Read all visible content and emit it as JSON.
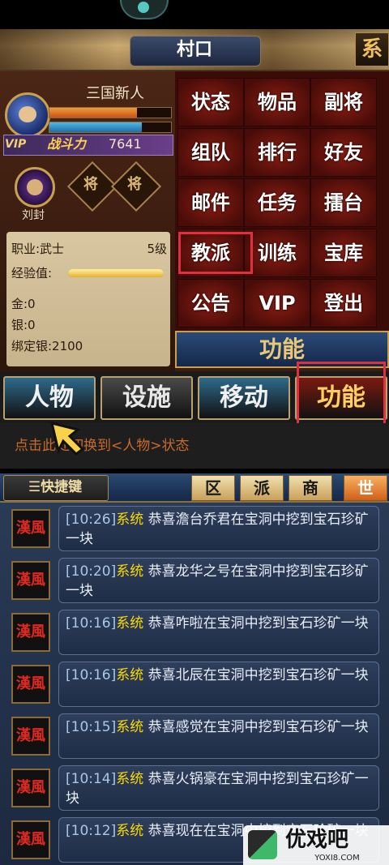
{
  "title": "村口",
  "title_right_glyph": "系",
  "character": {
    "name": "三国新人",
    "hp_fraction": 0.72,
    "mp_fraction": 0.76,
    "vip": "VIP",
    "power_label": "战斗力",
    "power_value": "7641"
  },
  "general": {
    "name": "刘封",
    "slot1": "将",
    "slot2": "将"
  },
  "info": {
    "career": "职业:武士",
    "level": "5级",
    "exp_label": "经验值:",
    "exp_fraction": 1.0,
    "gold": "金:0",
    "silver": "银:0",
    "bound_silver": "绑定银:2100"
  },
  "menu": {
    "rows": [
      [
        "状态",
        "物品",
        "副将"
      ],
      [
        "组队",
        "排行",
        "好友"
      ],
      [
        "邮件",
        "任务",
        "擂台"
      ],
      [
        "教派",
        "训练",
        "宝库"
      ],
      [
        "公告",
        "VIP",
        "登出"
      ]
    ],
    "header": "功能"
  },
  "tabs": [
    {
      "label": "人物",
      "color": "#f0f0f0",
      "bg": "#2e6a8a"
    },
    {
      "label": "设施",
      "color": "#e8e8e8",
      "bg": "#4a4a4a"
    },
    {
      "label": "移动",
      "color": "#f0f0f0",
      "bg": "#2e6a8a"
    },
    {
      "label": "功能",
      "color": "#ffd060",
      "bg": "#7a1a10"
    }
  ],
  "hint": "点击此处切换到<人物>状态",
  "shortcut": "☰快捷键",
  "channels": [
    "区",
    "派",
    "商",
    "世"
  ],
  "messages": [
    {
      "time": "[10:26]",
      "source": "系统",
      "text": "恭喜澹台乔君在宝洞中挖到宝石珍矿一块"
    },
    {
      "time": "[10:20]",
      "source": "系统",
      "text": "恭喜龙华之号在宝洞中挖到宝石珍矿一块"
    },
    {
      "time": "[10:16]",
      "source": "系统",
      "text": "恭喜咋啦在宝洞中挖到宝石珍矿一块"
    },
    {
      "time": "[10:16]",
      "source": "系统",
      "text": "恭喜北辰在宝洞中挖到宝石珍矿一块"
    },
    {
      "time": "[10:15]",
      "source": "系统",
      "text": "恭喜感觉在宝洞中挖到宝石珍矿一块"
    },
    {
      "time": "[10:14]",
      "source": "系统",
      "text": "恭喜火锅豪在宝洞中挖到宝石珍矿一块"
    },
    {
      "time": "[10:12]",
      "source": "系统",
      "text": "恭喜现在在宝洞中挖到宝石珍矿一块"
    }
  ],
  "message_icon_glyph": "漢風",
  "watermark": {
    "name": "优戏吧",
    "url": "YOXI8.COM"
  }
}
